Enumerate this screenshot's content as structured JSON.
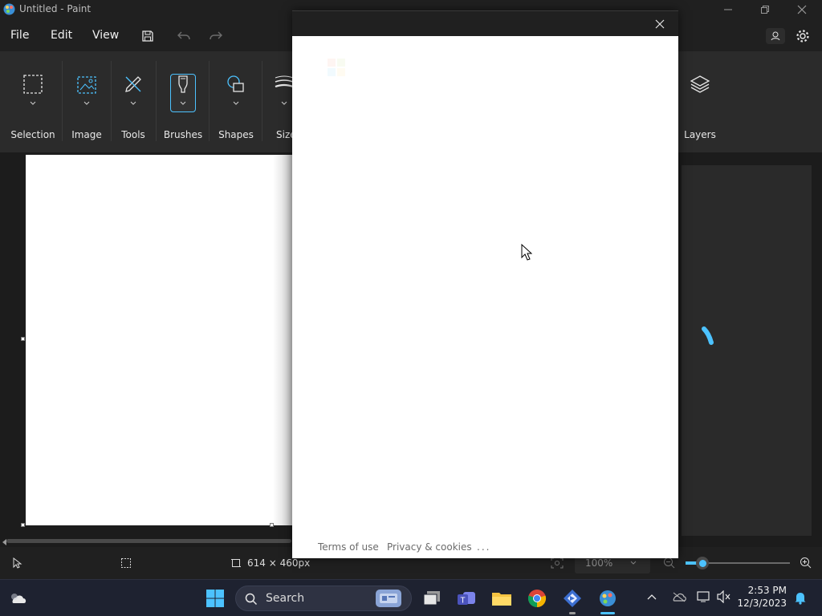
{
  "window": {
    "title": "Untitled - Paint"
  },
  "menu": {
    "file": "File",
    "edit": "Edit",
    "view": "View"
  },
  "ribbon": {
    "groups": [
      {
        "label": "Selection"
      },
      {
        "label": "Image"
      },
      {
        "label": "Tools"
      },
      {
        "label": "Brushes"
      },
      {
        "label": "Shapes"
      },
      {
        "label": "Size"
      }
    ],
    "layers": "Layers"
  },
  "status": {
    "canvas_size": "614 × 460px",
    "zoom": "100%"
  },
  "dialog": {
    "links": {
      "terms": "Terms of use",
      "privacy": "Privacy & cookies",
      "more": "..."
    }
  },
  "taskbar": {
    "search": "Search",
    "time": "2:53 PM",
    "date": "12/3/2023"
  },
  "colors": {
    "accent": "#4cc2ff",
    "ribbon_bg": "#2b2b2b",
    "app_bg": "#202020",
    "taskbar_bg": "#1e2230"
  }
}
